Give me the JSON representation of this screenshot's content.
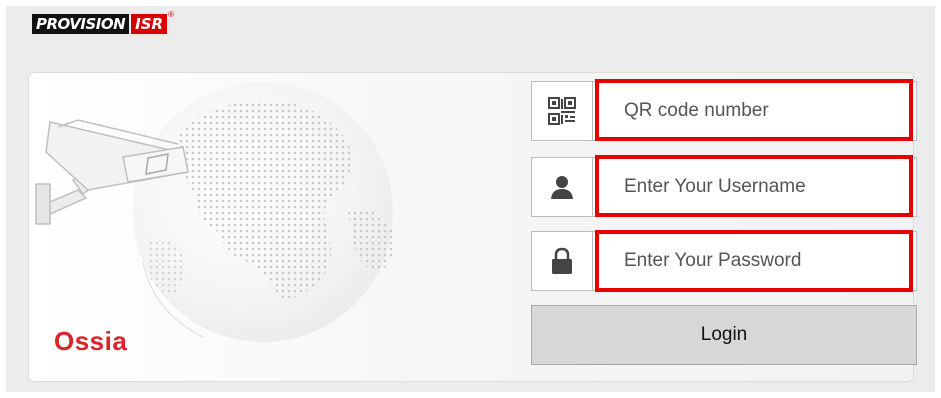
{
  "logo": {
    "brand_main": "PROVISION",
    "brand_isr": "ISR",
    "registered": "®"
  },
  "brand_name": "Ossia",
  "form": {
    "qr_placeholder": "QR code number",
    "username_placeholder": "Enter Your Username",
    "password_placeholder": "Enter Your Password",
    "login_label": "Login"
  },
  "colors": {
    "highlight": "#e60000",
    "brand_red": "#d9252a",
    "logo_red": "#d90000"
  },
  "icons": {
    "qr": "qr-code-icon",
    "user": "user-icon",
    "lock": "lock-icon"
  }
}
